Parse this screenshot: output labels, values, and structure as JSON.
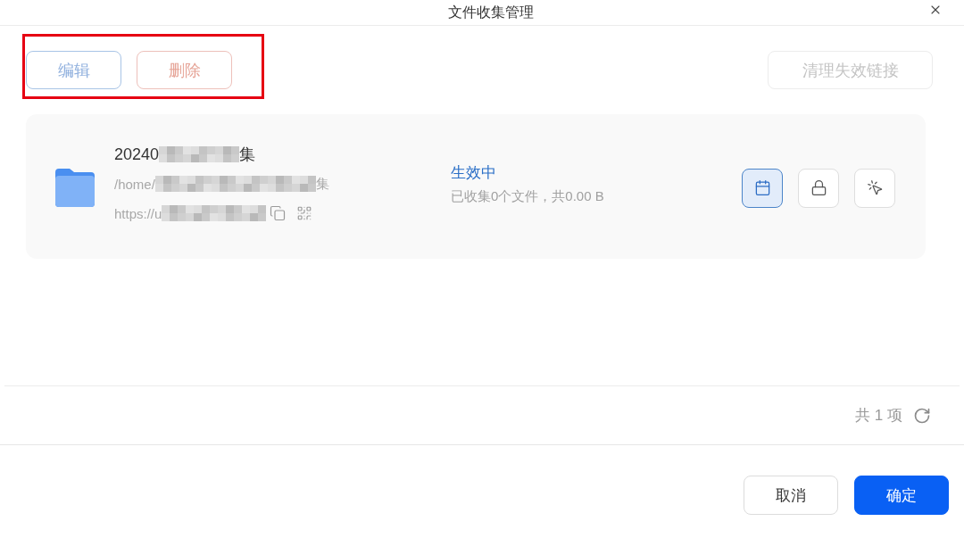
{
  "dialog": {
    "title": "文件收集管理"
  },
  "toolbar": {
    "highlighted": true,
    "left_buttons": [
      {
        "label": "编辑",
        "kind": "info",
        "disabled": true
      },
      {
        "label": "删除",
        "kind": "danger",
        "disabled": true
      }
    ],
    "right_button": {
      "label": "清理失效链接",
      "kind": "default",
      "disabled": true
    }
  },
  "collections": [
    {
      "name": {
        "start": "20240",
        "redacted": true,
        "end": "集"
      },
      "path": {
        "start": "/home/",
        "redacted": true,
        "end": "集"
      },
      "link": {
        "start": "https://u",
        "redacted": true
      },
      "status": "生效中",
      "summary": "已收集0个文件，共0.00 B",
      "actions": [
        {
          "active": true
        },
        {
          "active": false
        },
        {
          "active": false
        }
      ]
    }
  ],
  "footer": {
    "count": "共 1 项"
  },
  "buttons": [
    {
      "label": "取消",
      "kind": "default"
    },
    {
      "label": "确定",
      "kind": "primary"
    }
  ]
}
